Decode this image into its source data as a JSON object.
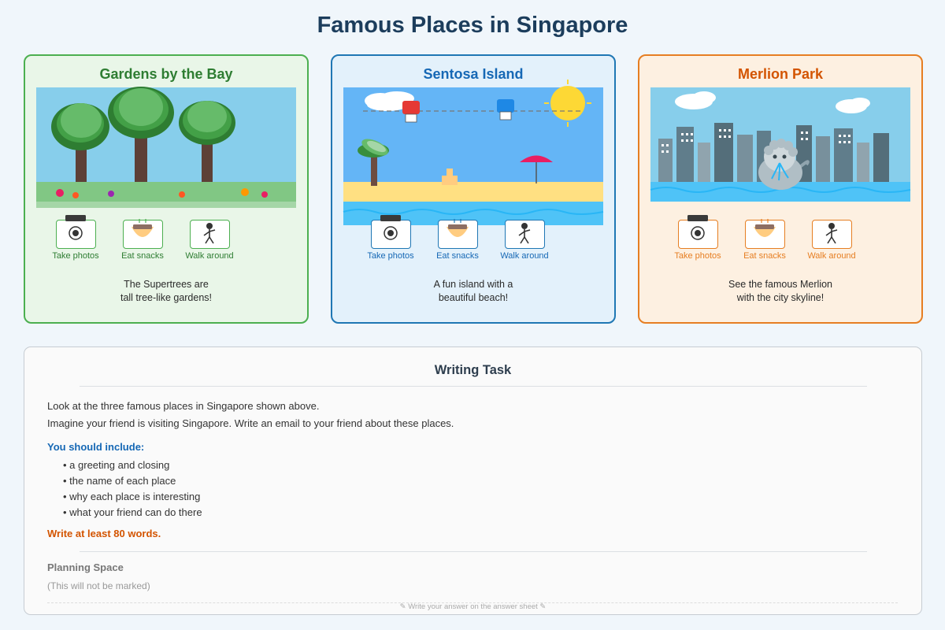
{
  "page_title": "Famous Places in Singapore",
  "colors": {
    "background": "#f0f6fb",
    "title": "#1c3d5c",
    "gardens_accent": "#4caf50",
    "sentosa_accent": "#1f77b4",
    "merlion_accent": "#e67e22",
    "include_heading": "#1668b5",
    "word_count": "#d35400"
  },
  "cards": [
    {
      "title": "Gardens by the Bay",
      "scene": "supertree-grove",
      "activities": [
        {
          "label": "Take photos",
          "icon": "camera-icon"
        },
        {
          "label": "Eat snacks",
          "icon": "snack-bowl-icon"
        },
        {
          "label": "Walk around",
          "icon": "walking-person-icon"
        }
      ],
      "description_line1": "The Supertrees are",
      "description_line2": "tall tree-like gardens!"
    },
    {
      "title": "Sentosa Island",
      "scene": "beach-with-cable-cars",
      "activities": [
        {
          "label": "Take photos",
          "icon": "camera-icon"
        },
        {
          "label": "Eat snacks",
          "icon": "snack-bowl-icon"
        },
        {
          "label": "Walk around",
          "icon": "walking-person-icon"
        }
      ],
      "description_line1": "A fun island with a",
      "description_line2": "beautiful beach!"
    },
    {
      "title": "Merlion Park",
      "scene": "merlion-and-skyline",
      "activities": [
        {
          "label": "Take photos",
          "icon": "camera-icon"
        },
        {
          "label": "Eat snacks",
          "icon": "snack-bowl-icon"
        },
        {
          "label": "Walk around",
          "icon": "walking-person-icon"
        }
      ],
      "description_line1": "See the famous Merlion",
      "description_line2": "with the city skyline!"
    }
  ],
  "task": {
    "title": "Writing Task",
    "instruction_line1": "Look at the three famous places in Singapore shown above.",
    "instruction_line2": "Imagine your friend is visiting Singapore. Write an email to your friend about these places.",
    "include_heading": "You should include:",
    "include_items": [
      "a greeting and closing",
      "the name of each place",
      "why each place is interesting",
      "what your friend can do there"
    ],
    "word_requirement": "Write at least 80 words.",
    "planning_heading": "Planning Space",
    "planning_note": "(This will not be marked)",
    "answer_note": "✎ Write your answer on the answer sheet ✎"
  }
}
